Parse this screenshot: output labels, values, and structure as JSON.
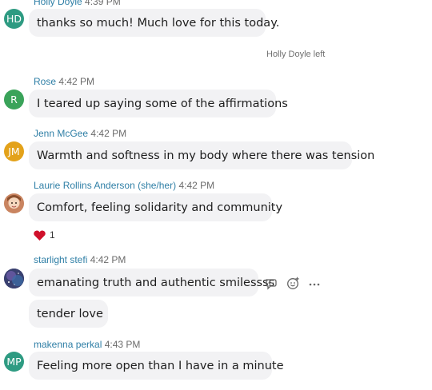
{
  "messages": [
    {
      "initials": "HD",
      "name": "Holly Doyle",
      "time": "4:39 PM",
      "avatar_color": "#2e9b82",
      "texts": [
        "thanks so much! Much love for this today."
      ]
    },
    {
      "initials": "R",
      "name": "Rose",
      "time": "4:42 PM",
      "avatar_color": "#3aa35a",
      "texts": [
        "I teared up saying some of the affirmations"
      ]
    },
    {
      "initials": "JM",
      "name": "Jenn McGee",
      "time": "4:42 PM",
      "avatar_color": "#e3a21a",
      "texts": [
        "Warmth and softness in my body where there was tension"
      ]
    },
    {
      "initials": "",
      "name": "Laurie Rollins Anderson (she/her)",
      "time": "4:42 PM",
      "avatar_color": "#c98460",
      "texts": [
        "Comfort, feeling solidarity and community"
      ]
    },
    {
      "initials": "",
      "name": "starlight stefi",
      "time": "4:42 PM",
      "avatar_color": "#4a4f8a",
      "texts": [
        "emanating truth and authentic smilessss",
        "tender love"
      ]
    },
    {
      "initials": "MP",
      "name": "makenna perkal",
      "time": "4:43 PM",
      "avatar_color": "#2e9b82",
      "texts": [
        "Feeling more open than I have in a minute"
      ]
    }
  ],
  "system_event": "Holly Doyle left",
  "reaction": {
    "emoji": "heart-icon",
    "count": "1",
    "color": "#d0102b"
  },
  "hover_actions": [
    "reply-icon",
    "emoji-icon",
    "more-icon"
  ]
}
